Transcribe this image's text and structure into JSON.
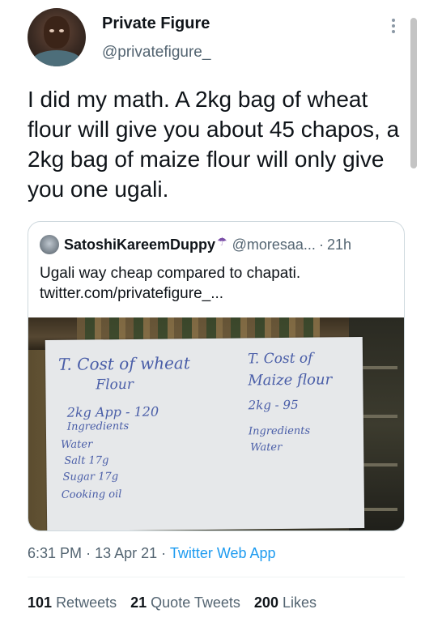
{
  "author": {
    "name": "Private Figure",
    "handle": "@privatefigure_"
  },
  "tweet": {
    "text": "I did my math. A 2kg bag of wheat flour will give you about 45 chapos, a 2kg bag of maize flour will only give you one ugali."
  },
  "quoted": {
    "name": "SatoshiKareemDuppy",
    "badge_icon": "umbrella-icon",
    "handle": "@moresaa...",
    "separator": "·",
    "time": "21h",
    "text_line1": "Ugali way cheap compared to  chapati.",
    "text_line2": "twitter.com/privatefigure_...",
    "image_text": {
      "left_title": "T. Cost of wheat",
      "left_sub": "Flour",
      "left_price": "2kg  App - 120",
      "left_ing": "Ingredients",
      "left_items": [
        "Water",
        "Salt  17g",
        "Sugar  17g",
        "Cooking  oil"
      ],
      "right_title": "T. Cost of",
      "right_sub": "Maize flour",
      "right_price": "2kg - 95",
      "right_ing": "Ingredients",
      "right_items": [
        "Water"
      ]
    }
  },
  "meta": {
    "time": "6:31 PM",
    "dot": "·",
    "date": "13 Apr 21",
    "source": "Twitter Web App"
  },
  "stats": {
    "retweets_count": "101",
    "retweets_label": "Retweets",
    "quotes_count": "21",
    "quotes_label": "Quote Tweets",
    "likes_count": "200",
    "likes_label": "Likes"
  },
  "colors": {
    "link": "#1d9bf0",
    "secondary_text": "#536471",
    "primary_text": "#0f1419",
    "border": "#cfd9de"
  }
}
